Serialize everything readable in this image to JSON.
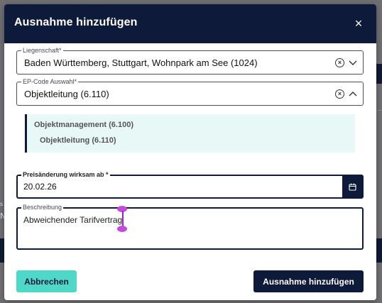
{
  "modal": {
    "title": "Ausnahme hinzufügen",
    "close_glyph": "×"
  },
  "property_field": {
    "label": "Liegenschaft*",
    "value": "Baden Württemberg, Stuttgart, Wohnpark am See (1024)"
  },
  "ep_code_field": {
    "label": "EP-Code Auswahl*",
    "value": "Objektleitung (6.110)"
  },
  "ep_code_options": [
    "Objektmanagement (6.100)",
    "Objektleitung (6.110)"
  ],
  "date_field": {
    "label": "Preisänderung wirksam ab *",
    "value": "20.02.26"
  },
  "description_field": {
    "label": "Beschreibung",
    "value": "Abweichender Tarifvertrag"
  },
  "buttons": {
    "cancel": "Abbrechen",
    "submit": "Ausnahme hinzufügen"
  },
  "background": {
    "fragment_1": "s",
    "fragment_2": "N"
  },
  "colors": {
    "header_bg": "#0e1a3a",
    "accent_teal": "#4fd8c8",
    "options_bg": "#e7f8f6",
    "caret": "#c44ae0"
  }
}
